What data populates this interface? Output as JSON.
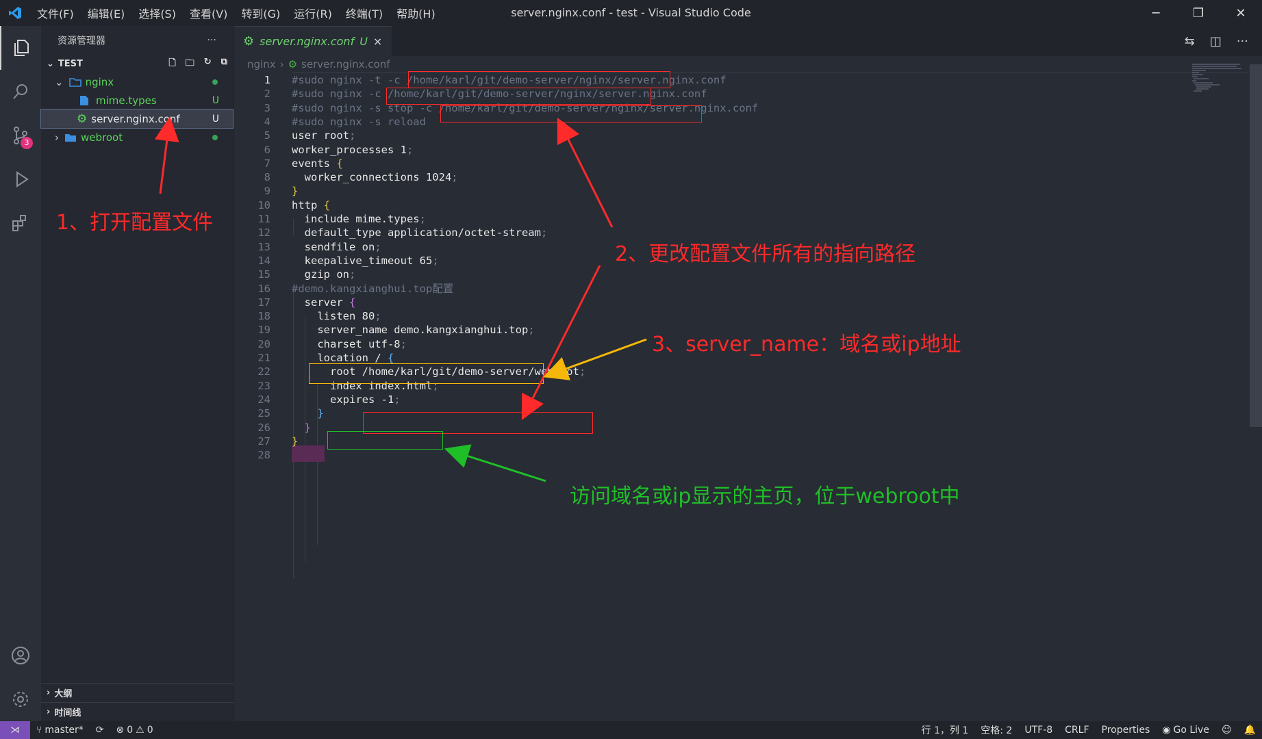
{
  "window": {
    "title": "server.nginx.conf - test - Visual Studio Code"
  },
  "menu": [
    "文件(F)",
    "编辑(E)",
    "选择(S)",
    "查看(V)",
    "转到(G)",
    "运行(R)",
    "终端(T)",
    "帮助(H)"
  ],
  "activity": {
    "scm_badge": "3"
  },
  "sidebar": {
    "title": "资源管理器",
    "more": "···",
    "section": "TEST",
    "tree": [
      {
        "label": "nginx",
        "status": ""
      },
      {
        "label": "mime.types",
        "status": "U"
      },
      {
        "label": "server.nginx.conf",
        "status": "U"
      },
      {
        "label": "webroot",
        "status": ""
      }
    ],
    "outline": "大纲",
    "timeline": "时间线"
  },
  "tab": {
    "label": "server.nginx.conf",
    "status": "U",
    "close": "×"
  },
  "breadcrumb": {
    "folder": "nginx",
    "file": "server.nginx.conf"
  },
  "code": {
    "line_numbers": [
      "1",
      "2",
      "3",
      "4",
      "5",
      "6",
      "7",
      "8",
      "9",
      "10",
      "11",
      "12",
      "13",
      "14",
      "15",
      "16",
      "17",
      "18",
      "19",
      "20",
      "21",
      "22",
      "23",
      "24",
      "25",
      "26",
      "27",
      "28"
    ],
    "l1": "#sudo nginx -t -c /home/karl/git/demo-server/nginx/server.nginx.conf",
    "l2": "#sudo nginx -c /home/karl/git/demo-server/nginx/server.nginx.conf",
    "l3": "#sudo nginx -s stop -c /home/karl/git/demo-server/nginx/server.nginx.conf",
    "l4": "#sudo nginx -s reload",
    "l5a": "user root",
    "l5b": ";",
    "l6a": "worker_processes 1",
    "l6b": ";",
    "l7a": "events ",
    "l7b": "{",
    "l8a": "  worker_connections 1024",
    "l8b": ";",
    "l9": "}",
    "l10a": "http ",
    "l10b": "{",
    "l11a": "  include mime.types",
    "l11b": ";",
    "l12a": "  default_type application/octet-stream",
    "l12b": ";",
    "l13a": "  sendfile on",
    "l13b": ";",
    "l14a": "  keepalive_timeout 65",
    "l14b": ";",
    "l15a": "  gzip on",
    "l15b": ";",
    "l16": "#demo.kangxianghui.top配置",
    "l17a": "  server ",
    "l17b": "{",
    "l18a": "    listen 80",
    "l18b": ";",
    "l19a": "    server_name demo.kangxianghui.top",
    "l19b": ";",
    "l20a": "    charset utf-8",
    "l20b": ";",
    "l21a": "    location / ",
    "l21b": "{",
    "l22a": "      root /home/karl/git/demo-server/webroot",
    "l22b": ";",
    "l23a": "      index index.html",
    "l23b": ";",
    "l24a": "      expires -1",
    "l24b": ";",
    "l25": "    }",
    "l26": "  }",
    "l27": "}",
    "l28": ""
  },
  "annotations": {
    "a1": "1、打开配置文件",
    "a2": "2、更改配置文件所有的指向路径",
    "a3": "3、server_name：域名或ip地址",
    "a4": "访问域名或ip显示的主页，位于webroot中"
  },
  "colors": {
    "red": "#ff2a2a",
    "orange": "#f5b80a",
    "green": "#1fbf28"
  },
  "status": {
    "branch": "master*",
    "errors": "0",
    "warnings": "0",
    "position": "行 1，列 1",
    "spaces": "空格: 2",
    "encoding": "UTF-8",
    "eol": "CRLF",
    "language": "Properties",
    "golive": "Go Live"
  }
}
